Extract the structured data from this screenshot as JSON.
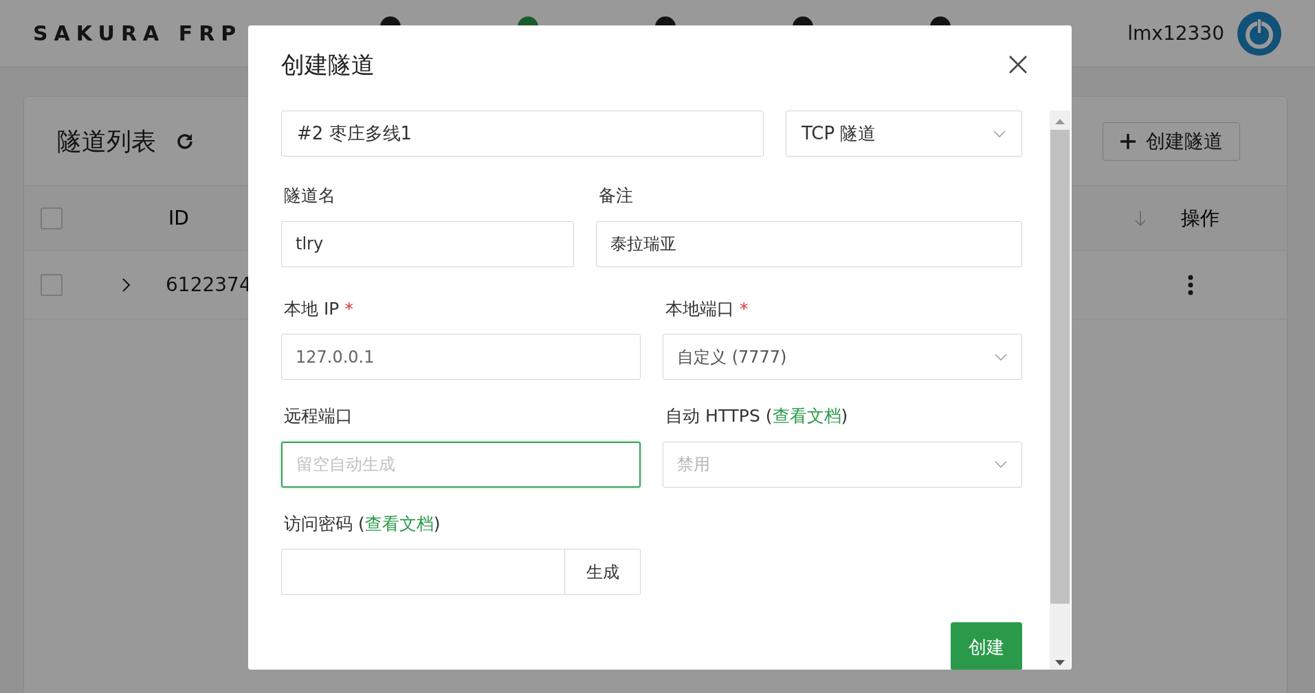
{
  "header": {
    "brand": "SAKURA FRP",
    "nav": [
      {
        "selected": false
      },
      {
        "selected": true
      },
      {
        "selected": false
      },
      {
        "selected": false
      },
      {
        "selected": false
      }
    ],
    "username": "lmx12330"
  },
  "card": {
    "title": "隧道列表",
    "create_button": "创建隧道",
    "columns": [
      "ID",
      "操作"
    ],
    "rows": [
      {
        "id": "6122374",
        "checked": false
      }
    ],
    "header_checked": false
  },
  "dialog": {
    "title": "创建隧道",
    "node": "#2 枣庄多线1",
    "type": "TCP 隧道",
    "fields": [
      {
        "label": "隧道名",
        "value": "tlry",
        "focused": false,
        "kind": "input"
      },
      {
        "label": "备注",
        "value": "泰拉瑞亚",
        "focused": false,
        "kind": "input"
      },
      {
        "label": "本地 IP",
        "required_mark": "*",
        "value": "127.0.0.1",
        "kind": "input"
      },
      {
        "label": "本地端口",
        "required_mark": "*",
        "value": "自定义 (7777)",
        "kind": "select"
      },
      {
        "label": "远程端口",
        "placeholder": "留空自动生成",
        "focused": true,
        "kind": "input"
      },
      {
        "label": "自动 HTTPS (",
        "link": "查看文档",
        "label_end": ")",
        "value": "禁用",
        "disabled": true,
        "kind": "select"
      },
      {
        "label": "访问密码 (",
        "link": "查看文档",
        "label_end": ")",
        "button": "生成",
        "kind": "password"
      }
    ],
    "submit": "创建"
  }
}
